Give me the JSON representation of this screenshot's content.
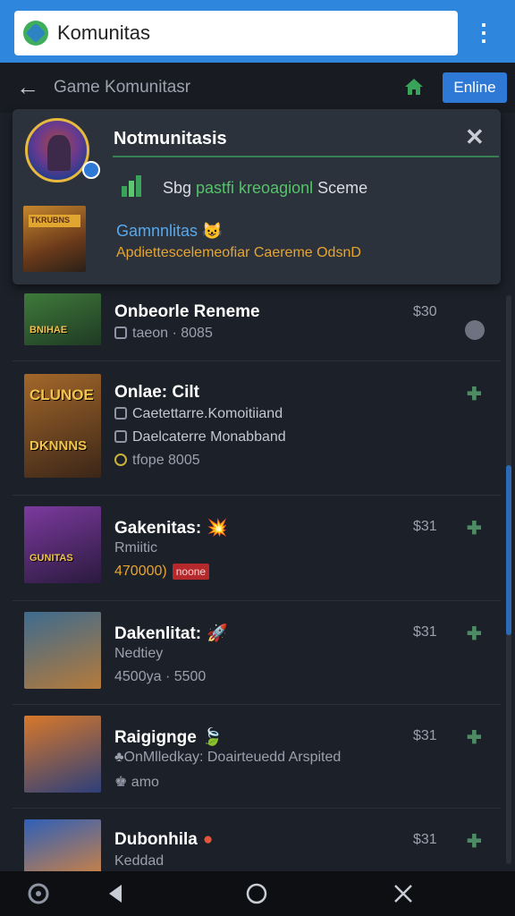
{
  "browser": {
    "url": "Komunitas",
    "menu_icon": "kebab-menu-icon"
  },
  "header": {
    "title": "Game Komunitasr",
    "online_button": "Enline",
    "back_icon": "back-arrow-icon",
    "home_icon": "home-icon"
  },
  "notification": {
    "title": "Notmunitasis",
    "message_prefix": "Sbg ",
    "message_highlight": "pastfi kreoagionl ",
    "message_suffix": "Sceme",
    "link": "Gamnnlitas",
    "link_emoji": "😺",
    "subtitle": "Apdiettescelemeofiar Caereme OdsnD",
    "thumb_label": "TKRUBNS"
  },
  "games": [
    {
      "title": "Onbeorle Reneme",
      "lines": [
        "taeon · 8085"
      ],
      "price": "$30",
      "action": "more",
      "thumb_label": "BNIHAE",
      "colors": [
        "#3f7a3a",
        "#1f3a24"
      ]
    },
    {
      "title": "Onlae: Cilt",
      "lines": [
        "Caetettarre.Komoitiiand",
        "Daelcaterre Monabband",
        "tfope 8005"
      ],
      "price": "",
      "action": "add",
      "thumb_label": "CLUNOE",
      "thumb_label2": "DKNNNS",
      "colors": [
        "#a3672a",
        "#3b2618"
      ]
    },
    {
      "title": "Gakenitas:",
      "title_emoji": "💥",
      "lines": [
        "Rmiitic",
        "470000)"
      ],
      "tag": "noone",
      "price": "$31",
      "action": "add",
      "thumb_label": "GUNITAS",
      "colors": [
        "#7c3a9e",
        "#2a1a3e"
      ]
    },
    {
      "title": "Dakenlitat:",
      "title_emoji": "🚀",
      "lines": [
        "Nedtiey",
        "4500ya · 5500"
      ],
      "price": "$31",
      "action": "add",
      "thumb_label": "",
      "colors": [
        "#3d6b8f",
        "#b57a3a"
      ]
    },
    {
      "title": "Raigignge",
      "title_emoji": "🍃",
      "lines": [
        "♣OnMlledkay: Doairteuedd Arspited",
        "♚ amo"
      ],
      "price": "$31",
      "action": "add",
      "thumb_label": "",
      "colors": [
        "#d8782a",
        "#2d3f7a"
      ]
    },
    {
      "title": "Dubonhila",
      "title_emoji": "●",
      "lines": [
        "Keddad"
      ],
      "price": "$31",
      "action": "add",
      "thumb_label": "",
      "colors": [
        "#2f5fb8",
        "#f08a2a"
      ]
    }
  ],
  "nav": {
    "assistant_icon": "assistant-icon",
    "back_icon": "nav-back-icon",
    "home_icon": "nav-home-icon",
    "close_icon": "nav-close-icon"
  },
  "colors": {
    "accent": "#2f86dd",
    "green": "#3aa35a",
    "background": "#1c2029"
  }
}
